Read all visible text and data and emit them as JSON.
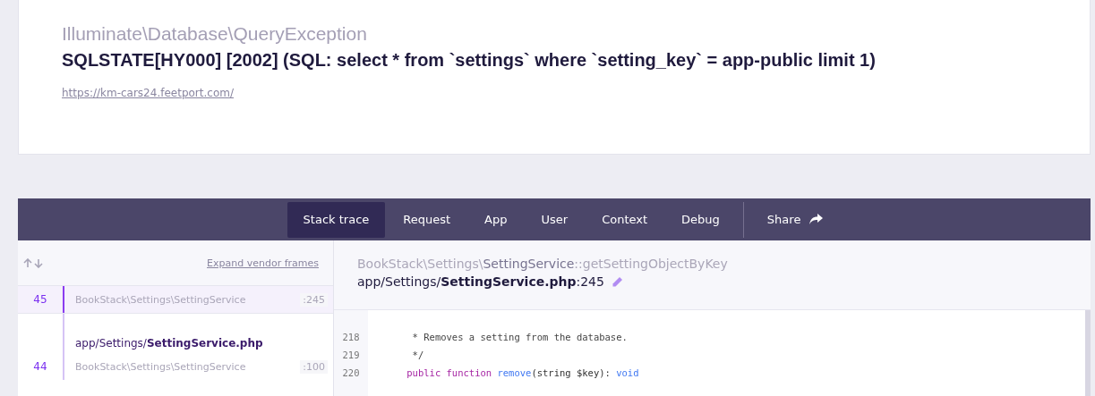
{
  "exception": {
    "class": "Illuminate\\Database\\QueryException",
    "message": "SQLSTATE[HY000] [2002] (SQL: select * from `settings` where `setting_key` = app-public limit 1)",
    "url": "https://km-cars24.feetport.com/"
  },
  "tabs": [
    {
      "label": "Stack trace",
      "selected": true
    },
    {
      "label": "Request",
      "selected": false
    },
    {
      "label": "App",
      "selected": false
    },
    {
      "label": "User",
      "selected": false
    },
    {
      "label": "Context",
      "selected": false
    },
    {
      "label": "Debug",
      "selected": false
    }
  ],
  "share": {
    "label": "Share"
  },
  "frames_header": {
    "expand_link": "Expand vendor frames"
  },
  "frames": [
    {
      "kind": "frame",
      "number": "45",
      "class": "BookStack\\Settings\\SettingService",
      "line": ":245",
      "selected": true
    },
    {
      "kind": "file",
      "path": "app/Settings/",
      "file": "SettingService.php"
    },
    {
      "kind": "frame",
      "number": "44",
      "class": "BookStack\\Settings\\SettingService",
      "line": ":100",
      "selected": false
    }
  ],
  "frame_detail": {
    "class": "BookStack\\Settings\\",
    "class_name": "SettingService",
    "method": "::getSettingObjectByKey",
    "path": "app/Settings/",
    "file": "SettingService.php",
    "line": ":245"
  },
  "code": [
    {
      "number": "218",
      "tokens": [
        {
          "kind": "comment",
          "text": "     * Removes a setting from the database."
        }
      ]
    },
    {
      "number": "219",
      "tokens": [
        {
          "kind": "comment",
          "text": "     */"
        }
      ]
    },
    {
      "number": "220",
      "tokens": [
        {
          "kind": "keyword",
          "text": "    public function "
        },
        {
          "kind": "function",
          "text": "remove"
        },
        {
          "kind": "plain",
          "text": "(string $key): "
        },
        {
          "kind": "type",
          "text": "void"
        }
      ]
    }
  ]
}
